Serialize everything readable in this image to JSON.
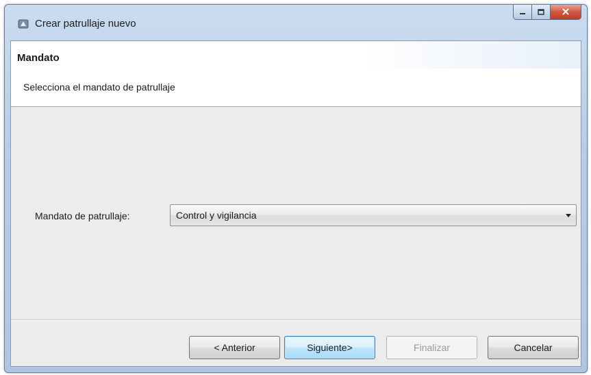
{
  "window": {
    "title": "Crear patrullaje nuevo",
    "app_icon": "wizard-app-icon"
  },
  "caption_buttons": {
    "minimize_icon": "minimize-icon",
    "maximize_icon": "maximize-icon",
    "close_icon": "close-icon"
  },
  "header": {
    "title": "Mandato",
    "description": "Selecciona el mandato de patrullaje"
  },
  "form": {
    "mandate_label": "Mandato de patrullaje:",
    "mandate_value": "Control y vigilancia"
  },
  "buttons": {
    "previous": "< Anterior",
    "next": "Siguiente>",
    "finish": "Finalizar",
    "cancel": "Cancelar"
  },
  "colors": {
    "close_button": "#c23f26",
    "default_button_border": "#3c7fb1",
    "disabled_text": "#9a9a9a"
  }
}
